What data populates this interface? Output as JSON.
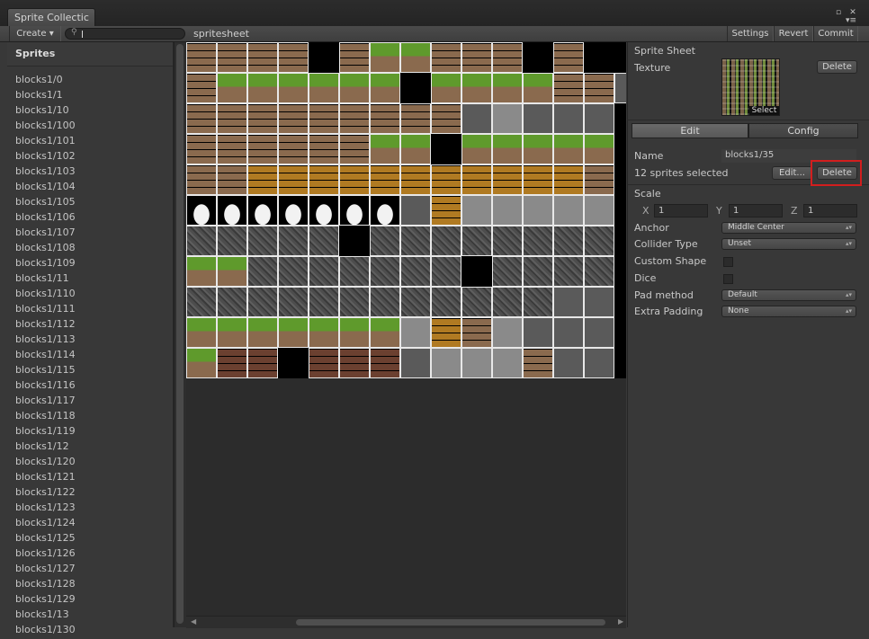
{
  "window": {
    "tab_title": "Sprite Collectic",
    "maximize_glyph": "▫",
    "close_glyph": "✕",
    "menu_glyph": "▾≡"
  },
  "toolbar": {
    "create_label": "Create ▾",
    "search_placeholder": "",
    "sheet_label": "spritesheet",
    "settings_label": "Settings",
    "revert_label": "Revert",
    "commit_label": "Commit"
  },
  "sprites": {
    "header": "Sprites",
    "items": [
      "blocks1/0",
      "blocks1/1",
      "blocks1/10",
      "blocks1/100",
      "blocks1/101",
      "blocks1/102",
      "blocks1/103",
      "blocks1/104",
      "blocks1/105",
      "blocks1/106",
      "blocks1/107",
      "blocks1/108",
      "blocks1/109",
      "blocks1/11",
      "blocks1/110",
      "blocks1/111",
      "blocks1/112",
      "blocks1/113",
      "blocks1/114",
      "blocks1/115",
      "blocks1/116",
      "blocks1/117",
      "blocks1/118",
      "blocks1/119",
      "blocks1/12",
      "blocks1/120",
      "blocks1/121",
      "blocks1/122",
      "blocks1/123",
      "blocks1/124",
      "blocks1/125",
      "blocks1/126",
      "blocks1/127",
      "blocks1/128",
      "blocks1/129",
      "blocks1/13",
      "blocks1/130"
    ]
  },
  "inspector": {
    "sprite_sheet_label": "Sprite Sheet",
    "texture_label": "Texture",
    "texture_delete_label": "Delete",
    "texture_select_label": "Select",
    "tab_edit": "Edit",
    "tab_config": "Config",
    "name_label": "Name",
    "name_value": "blocks1/35",
    "selection_text": "12 sprites selected",
    "edit_button": "Edit...",
    "delete_button": "Delete",
    "scale_label": "Scale",
    "scale_x_label": "X",
    "scale_x": "1",
    "scale_y_label": "Y",
    "scale_y": "1",
    "scale_z_label": "Z",
    "scale_z": "1",
    "anchor_label": "Anchor",
    "anchor_value": "Middle Center",
    "collider_label": "Collider Type",
    "collider_value": "Unset",
    "custom_shape_label": "Custom Shape",
    "dice_label": "Dice",
    "pad_method_label": "Pad method",
    "pad_method_value": "Default",
    "extra_padding_label": "Extra Padding",
    "extra_padding_value": "None"
  },
  "colors": {
    "selection_outline": "#d21e1e",
    "brick": "#8a6a4e",
    "grass": "#5f9a2c",
    "wood": "#b07a22",
    "stone": "#4d4d4d",
    "metal": "#8a8a8a",
    "cloud": "#f2f2f2",
    "empty": "#5a5a5a",
    "dirt": "#6b4030"
  },
  "spritesheet_grid": {
    "rows": [
      [
        "brick",
        "brick",
        "brick",
        "brick",
        "black",
        "brick",
        "grass",
        "grass",
        "brick",
        "brick",
        "brick",
        "black",
        "brick",
        "black",
        "black"
      ],
      [
        "brick",
        "grass",
        "grass",
        "grass",
        "grass",
        "grass",
        "grass",
        "black",
        "grass",
        "grass",
        "grass",
        "grass",
        "brick",
        "brick",
        "empty"
      ],
      [
        "brick",
        "brick",
        "brick",
        "brick",
        "brick",
        "brick",
        "brick",
        "brick",
        "brick",
        "empty",
        "metal",
        "empty",
        "empty",
        "empty",
        "black"
      ],
      [
        "brick",
        "brick",
        "brick",
        "brick",
        "brick",
        "brick",
        "grass",
        "grass",
        "black",
        "grass",
        "grass",
        "grass",
        "grass",
        "grass",
        "black"
      ],
      [
        "brick",
        "brick",
        "wood",
        "wood",
        "wood",
        "wood",
        "wood",
        "wood",
        "wood",
        "wood",
        "wood",
        "wood",
        "wood",
        "brick",
        "black"
      ],
      [
        "cloud",
        "cloud",
        "cloud",
        "cloud",
        "cloud",
        "cloud",
        "cloud",
        "empty",
        "wood",
        "metal",
        "metal",
        "metal",
        "metal",
        "metal",
        "black"
      ],
      [
        "stone",
        "stone",
        "stone",
        "stone",
        "stone",
        "black",
        "stone",
        "stone",
        "stone",
        "stone",
        "stone",
        "stone",
        "stone",
        "stone",
        "black"
      ],
      [
        "grass",
        "grass",
        "stone",
        "stone",
        "stone",
        "stone",
        "stone",
        "stone",
        "stone",
        "black",
        "stone",
        "stone",
        "stone",
        "stone",
        "black"
      ],
      [
        "stone",
        "stone",
        "stone",
        "stone",
        "stone",
        "stone",
        "stone",
        "stone",
        "stone",
        "stone",
        "stone",
        "stone",
        "empty",
        "empty",
        "black"
      ],
      [
        "grass",
        "grass",
        "grass",
        "grass",
        "grass",
        "grass",
        "grass",
        "metal",
        "wood",
        "brick",
        "metal",
        "empty",
        "empty",
        "empty",
        "black"
      ],
      [
        "grass",
        "dirt",
        "dirt",
        "black",
        "dirt",
        "dirt",
        "dirt",
        "empty",
        "metal",
        "metal",
        "metal",
        "brick",
        "empty",
        "empty",
        "black"
      ]
    ]
  }
}
